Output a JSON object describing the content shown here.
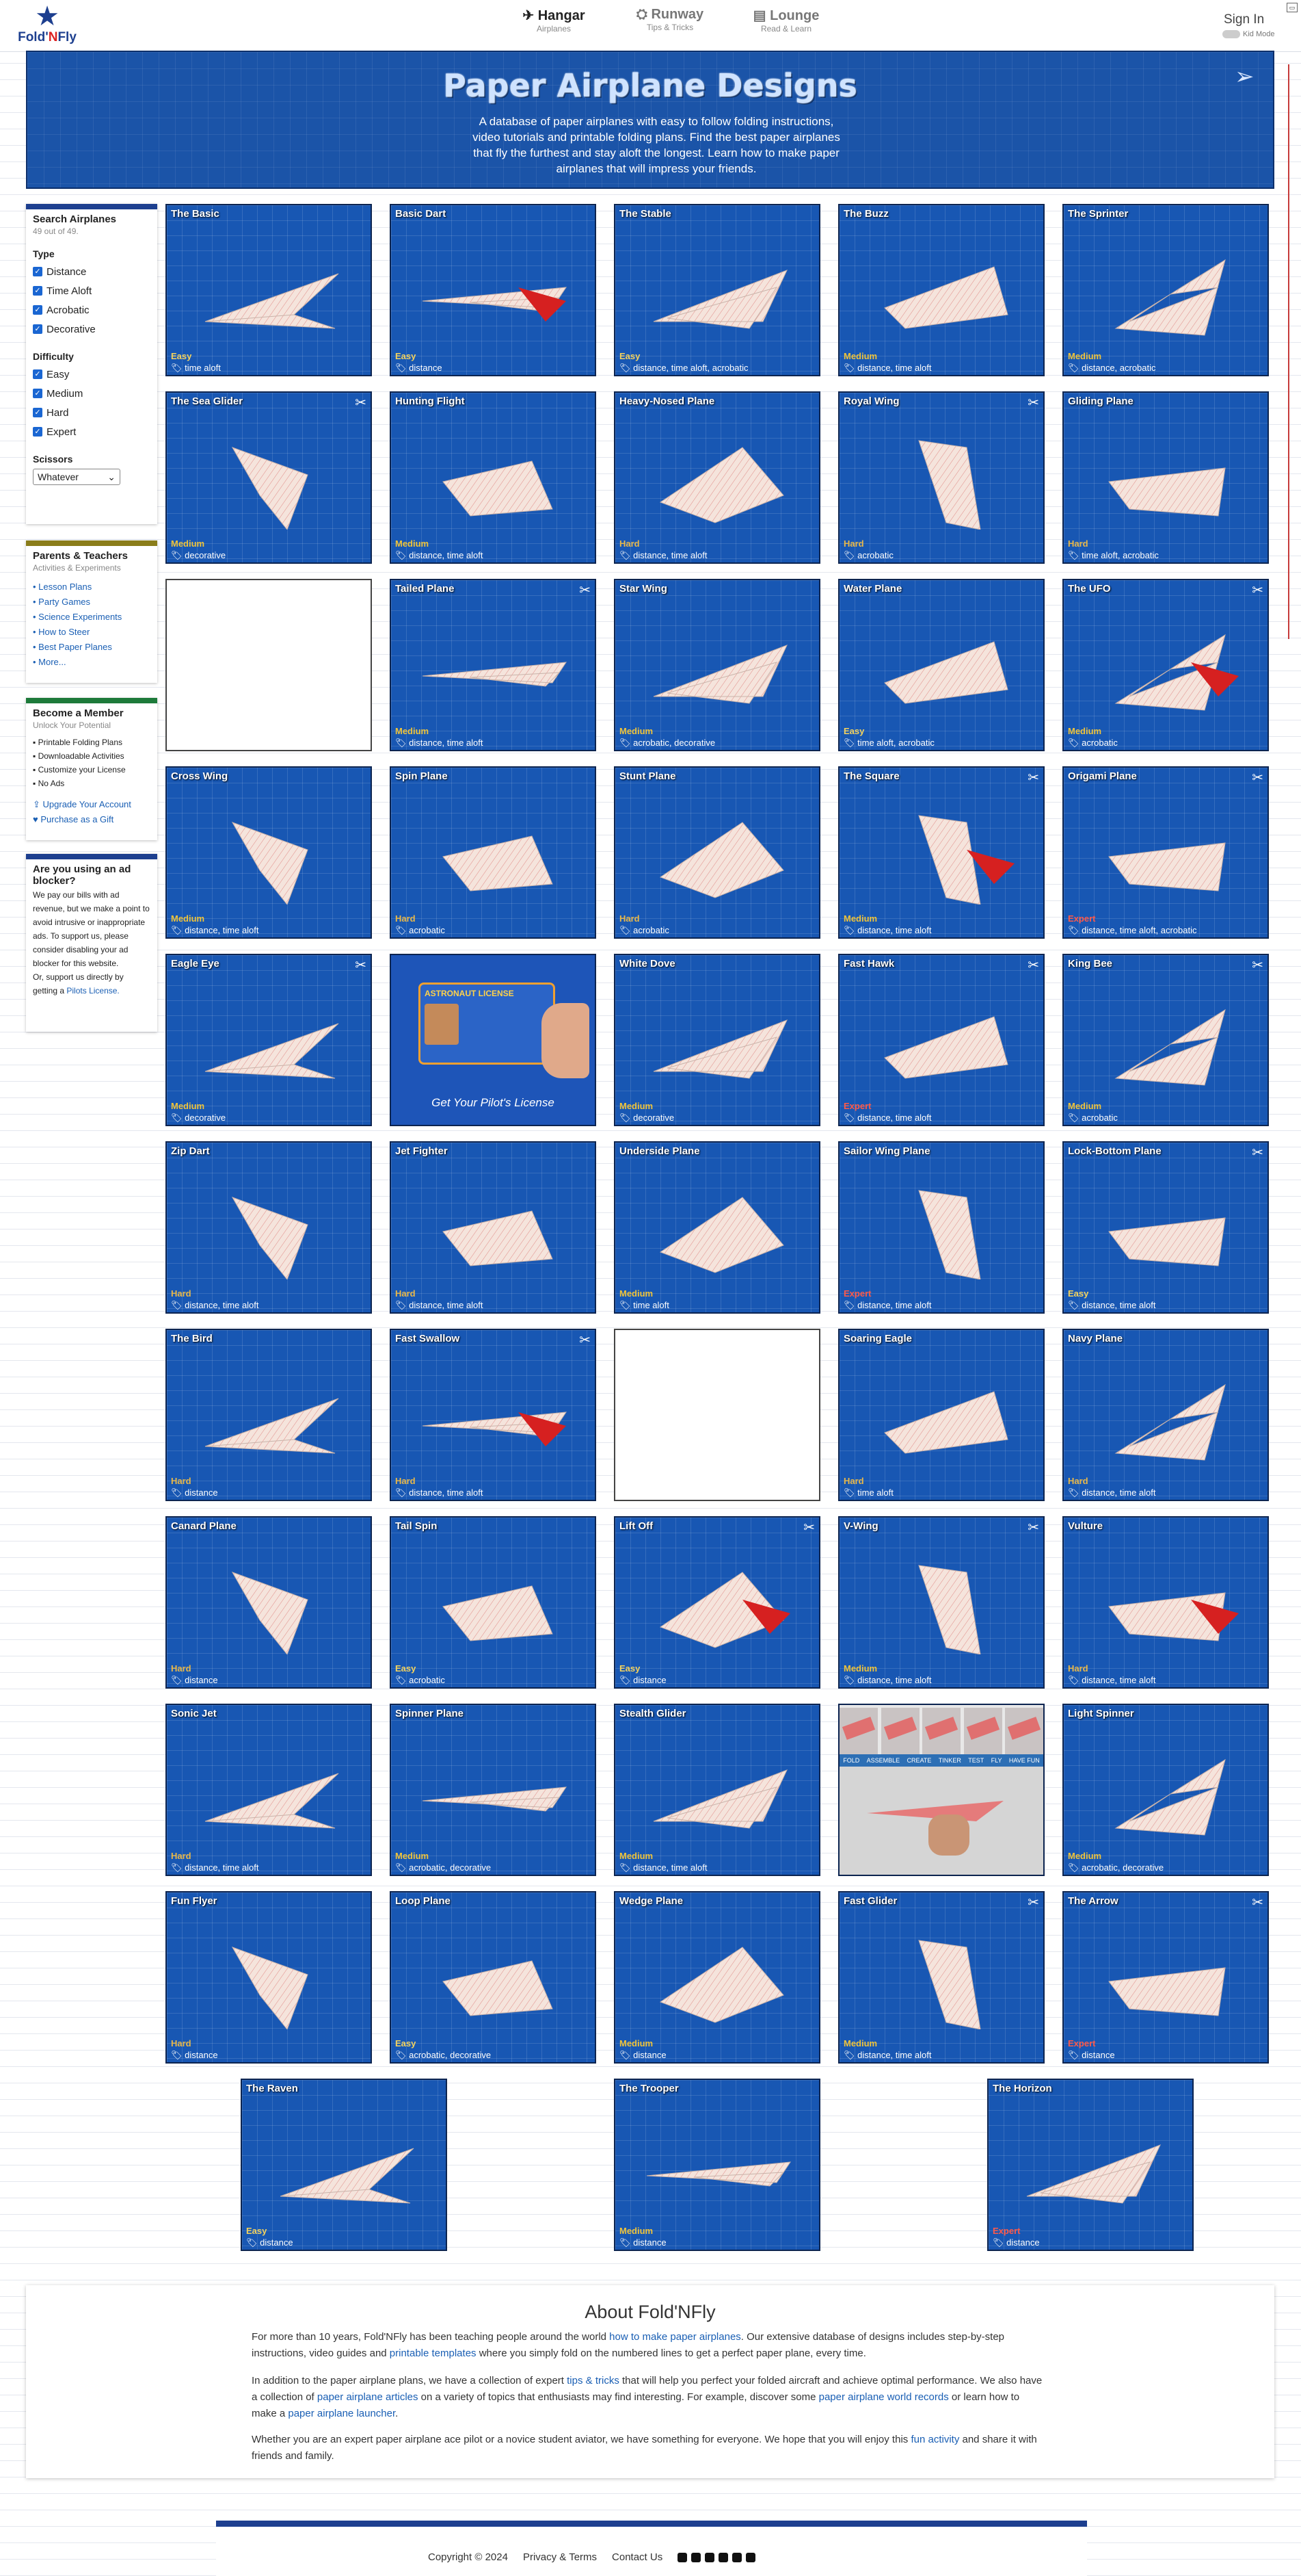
{
  "header": {
    "logo_text_a": "Fold'",
    "logo_text_b": "N",
    "logo_text_c": "Fly",
    "nav": [
      {
        "label": "Hangar",
        "sub": "Airplanes"
      },
      {
        "label": "Runway",
        "sub": "Tips & Tricks"
      },
      {
        "label": "Lounge",
        "sub": "Read & Learn"
      }
    ],
    "signin": "Sign In",
    "kidmode": "Kid Mode"
  },
  "banner": {
    "title": "Paper Airplane Designs",
    "text": "A database of paper airplanes with easy to follow folding instructions, video tutorials and printable folding plans. Find the best paper airplanes that fly the furthest and stay aloft the longest. Learn how to make paper airplanes that will impress your friends."
  },
  "search": {
    "title": "Search Airplanes",
    "count": "49 out of 49.",
    "type_label": "Type",
    "types": [
      "Distance",
      "Time Aloft",
      "Acrobatic",
      "Decorative"
    ],
    "difficulty_label": "Difficulty",
    "difficulties": [
      "Easy",
      "Medium",
      "Hard",
      "Expert"
    ],
    "scissors_label": "Scissors",
    "scissors_value": "Whatever"
  },
  "parents": {
    "title": "Parents & Teachers",
    "sub": "Activities & Experiments",
    "links": [
      "Lesson Plans",
      "Party Games",
      "Science Experiments",
      "How to Steer",
      "Best Paper Planes",
      "More..."
    ]
  },
  "member": {
    "title": "Become a Member",
    "sub": "Unlock Your Potential",
    "features": [
      "Printable Folding Plans",
      "Downloadable Activities",
      "Customize your License",
      "No Ads"
    ],
    "upgrade": "Upgrade Your Account",
    "gift": "Purchase as a Gift"
  },
  "adblock": {
    "title": "Are you using an ad blocker?",
    "text": "We pay our bills with ad revenue, but we make a point to avoid intrusive or inappropriate ads. To support us, please consider disabling your ad blocker for this website.",
    "text2": "Or, support us directly by getting a",
    "link": "Pilots License."
  },
  "planes": [
    {
      "name": "The Basic",
      "diff": "Easy",
      "tags": "time aloft",
      "sc": false
    },
    {
      "name": "Basic Dart",
      "diff": "Easy",
      "tags": "distance",
      "sc": false
    },
    {
      "name": "The Stable",
      "diff": "Easy",
      "tags": "distance, time aloft, acrobatic",
      "sc": false
    },
    {
      "name": "The Buzz",
      "diff": "Medium",
      "tags": "distance, time aloft",
      "sc": false
    },
    {
      "name": "The Sprinter",
      "diff": "Medium",
      "tags": "distance, acrobatic",
      "sc": false
    },
    {
      "name": "The Sea Glider",
      "diff": "Medium",
      "tags": "decorative",
      "sc": true
    },
    {
      "name": "Hunting Flight",
      "diff": "Medium",
      "tags": "distance, time aloft",
      "sc": false
    },
    {
      "name": "Heavy-Nosed Plane",
      "diff": "Hard",
      "tags": "distance, time aloft",
      "sc": false
    },
    {
      "name": "Royal Wing",
      "diff": "Hard",
      "tags": "acrobatic",
      "sc": true
    },
    {
      "name": "Gliding Plane",
      "diff": "Hard",
      "tags": "time aloft, acrobatic",
      "sc": false
    },
    {
      "name": "",
      "diff": "",
      "tags": "",
      "sc": false,
      "blank": true
    },
    {
      "name": "Tailed Plane",
      "diff": "Medium",
      "tags": "distance, time aloft",
      "sc": true
    },
    {
      "name": "Star Wing",
      "diff": "Medium",
      "tags": "acrobatic, decorative",
      "sc": false
    },
    {
      "name": "Water Plane",
      "diff": "Easy",
      "tags": "time aloft, acrobatic",
      "sc": false
    },
    {
      "name": "The UFO",
      "diff": "Medium",
      "tags": "acrobatic",
      "sc": true
    },
    {
      "name": "Cross Wing",
      "diff": "Medium",
      "tags": "distance, time aloft",
      "sc": false
    },
    {
      "name": "Spin Plane",
      "diff": "Hard",
      "tags": "acrobatic",
      "sc": false
    },
    {
      "name": "Stunt Plane",
      "diff": "Hard",
      "tags": "acrobatic",
      "sc": false
    },
    {
      "name": "The Square",
      "diff": "Medium",
      "tags": "distance, time aloft",
      "sc": true
    },
    {
      "name": "Origami Plane",
      "diff": "Expert",
      "tags": "distance, time aloft, acrobatic",
      "sc": true
    },
    {
      "name": "Eagle Eye",
      "diff": "Medium",
      "tags": "decorative",
      "sc": true
    },
    {
      "name": "",
      "diff": "",
      "tags": "",
      "sc": false,
      "license": true,
      "caption": "Get Your Pilot's License",
      "card": "ASTRONAUT LICENSE"
    },
    {
      "name": "White Dove",
      "diff": "Medium",
      "tags": "decorative",
      "sc": false
    },
    {
      "name": "Fast Hawk",
      "diff": "Expert",
      "tags": "distance, time aloft",
      "sc": true
    },
    {
      "name": "King Bee",
      "diff": "Medium",
      "tags": "acrobatic",
      "sc": true
    },
    {
      "name": "Zip Dart",
      "diff": "Hard",
      "tags": "distance, time aloft",
      "sc": false
    },
    {
      "name": "Jet Fighter",
      "diff": "Hard",
      "tags": "distance, time aloft",
      "sc": false
    },
    {
      "name": "Underside Plane",
      "diff": "Medium",
      "tags": "time aloft",
      "sc": false
    },
    {
      "name": "Sailor Wing Plane",
      "diff": "Expert",
      "tags": "distance, time aloft",
      "sc": false
    },
    {
      "name": "Lock-Bottom Plane",
      "diff": "Easy",
      "tags": "distance, time aloft",
      "sc": true
    },
    {
      "name": "The Bird",
      "diff": "Hard",
      "tags": "distance",
      "sc": false
    },
    {
      "name": "Fast Swallow",
      "diff": "Hard",
      "tags": "distance, time aloft",
      "sc": true
    },
    {
      "name": "",
      "diff": "",
      "tags": "",
      "sc": false,
      "blank": true
    },
    {
      "name": "Soaring Eagle",
      "diff": "Hard",
      "tags": "time aloft",
      "sc": false
    },
    {
      "name": "Navy Plane",
      "diff": "Hard",
      "tags": "distance, time aloft",
      "sc": false
    },
    {
      "name": "Canard Plane",
      "diff": "Hard",
      "tags": "distance",
      "sc": false
    },
    {
      "name": "Tail Spin",
      "diff": "Easy",
      "tags": "acrobatic",
      "sc": false
    },
    {
      "name": "Lift Off",
      "diff": "Easy",
      "tags": "distance",
      "sc": true
    },
    {
      "name": "V-Wing",
      "diff": "Medium",
      "tags": "distance, time aloft",
      "sc": true
    },
    {
      "name": "Vulture",
      "diff": "Hard",
      "tags": "distance, time aloft",
      "sc": false
    },
    {
      "name": "Sonic Jet",
      "diff": "Hard",
      "tags": "distance, time aloft",
      "sc": false
    },
    {
      "name": "Spinner Plane",
      "diff": "Medium",
      "tags": "acrobatic, decorative",
      "sc": false
    },
    {
      "name": "Stealth Glider",
      "diff": "Medium",
      "tags": "distance, time aloft",
      "sc": false
    },
    {
      "name": "",
      "diff": "",
      "tags": "",
      "sc": false,
      "launcher": true,
      "steps": [
        "FOLD",
        "ASSEMBLE",
        "CREATE",
        "TINKER",
        "TEST",
        "FLY",
        "HAVE FUN"
      ]
    },
    {
      "name": "Light Spinner",
      "diff": "Medium",
      "tags": "acrobatic, decorative",
      "sc": false
    },
    {
      "name": "Fun Flyer",
      "diff": "Hard",
      "tags": "distance",
      "sc": false
    },
    {
      "name": "Loop Plane",
      "diff": "Easy",
      "tags": "acrobatic, decorative",
      "sc": false
    },
    {
      "name": "Wedge Plane",
      "diff": "Medium",
      "tags": "distance",
      "sc": false
    },
    {
      "name": "Fast Glider",
      "diff": "Medium",
      "tags": "distance, time aloft",
      "sc": true
    },
    {
      "name": "The Arrow",
      "diff": "Expert",
      "tags": "distance",
      "sc": true
    },
    {
      "name": "The Raven",
      "diff": "Easy",
      "tags": "distance",
      "sc": false
    },
    {
      "name": "The Trooper",
      "diff": "Medium",
      "tags": "distance",
      "sc": false
    },
    {
      "name": "The Horizon",
      "diff": "Expert",
      "tags": "distance",
      "sc": false
    }
  ],
  "about": {
    "title": "About Fold'NFly",
    "p1a": "For more than 10 years, Fold'NFly has been teaching people around the world",
    "p1l1": "how to make paper airplanes",
    "p1b": ". Our extensive database of designs includes step-by-step instructions, video guides and",
    "p1l2": "printable templates",
    "p1c": "where you simply fold on the numbered lines to get a perfect paper plane, every time.",
    "p2a": "In addition to the paper airplane plans, we have a collection of expert",
    "p2l1": "tips & tricks",
    "p2b": "that will help you perfect your folded aircraft and achieve optimal performance. We also have a collection of",
    "p2l2": "paper airplane articles",
    "p2c": "on a variety of topics that enthusiasts may find interesting. For example, discover some",
    "p2l3": "paper airplane world records",
    "p2d": "or learn how to make a",
    "p2l4": "paper airplane launcher",
    "p3a": "Whether you are an expert paper airplane ace pilot or a novice student aviator, we have something for everyone. We hope that you will enjoy this",
    "p3l1": "fun activity",
    "p3b": "and share it with friends and family."
  },
  "footer": {
    "copyright": "Copyright © 2024",
    "privacy": "Privacy & Terms",
    "contact": "Contact Us"
  },
  "colors": {
    "brand": "#1d3f8f",
    "tile": "#1857b3",
    "accent_red": "#d22"
  }
}
